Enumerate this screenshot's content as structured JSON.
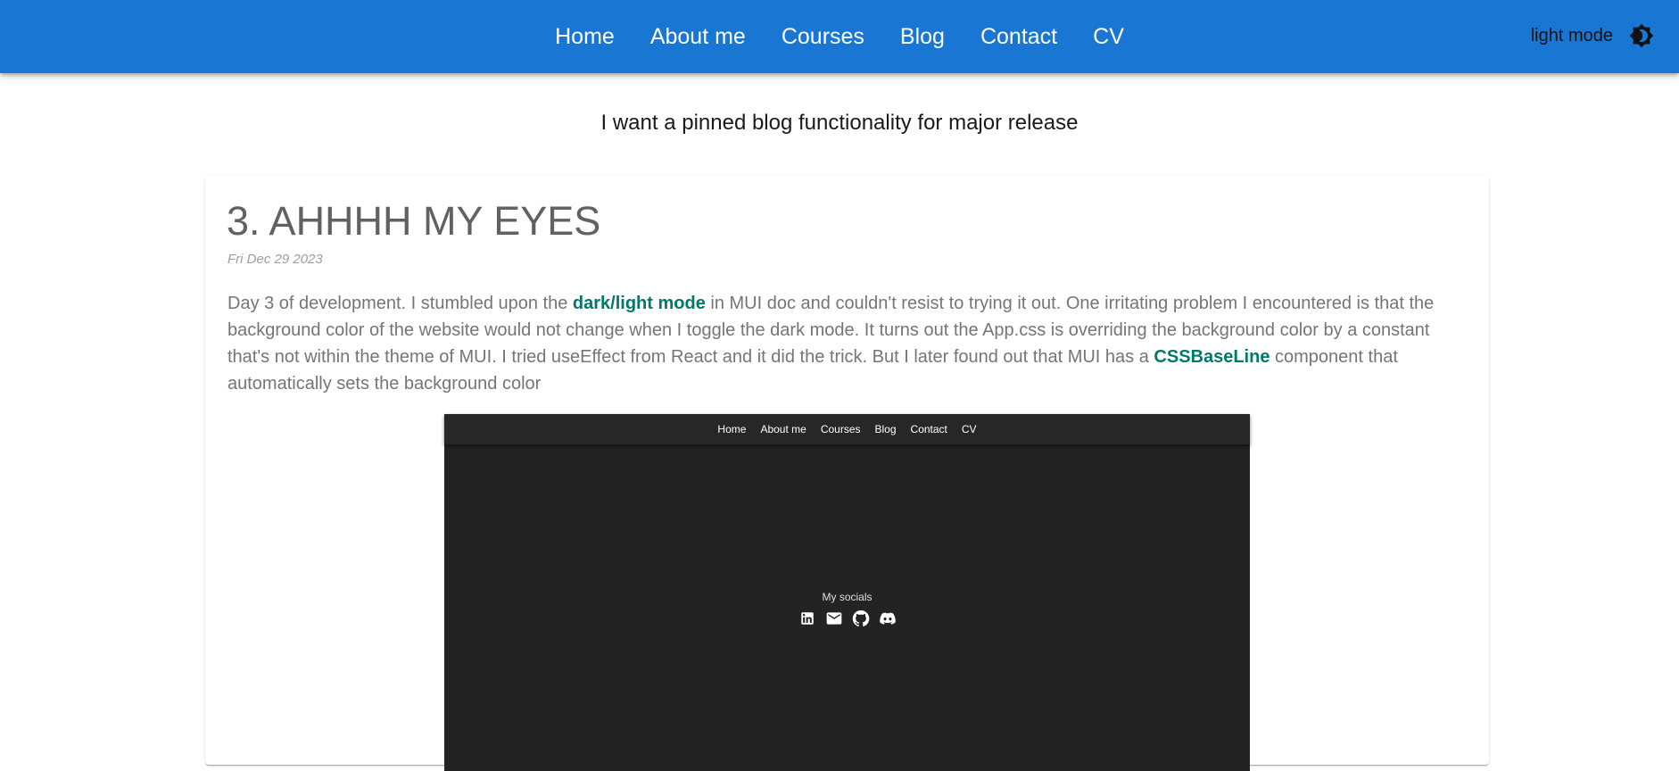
{
  "nav": {
    "items": [
      "Home",
      "About me",
      "Courses",
      "Blog",
      "Contact",
      "CV"
    ]
  },
  "theme_toggle": {
    "label": "light mode",
    "icon": "brightness-icon"
  },
  "pinned_message": "I want a pinned blog functionality for major release",
  "post": {
    "title": "3. AHHHH MY EYES",
    "date": "Fri Dec 29 2023",
    "body_part1": "Day 3 of development. I stumbled upon the ",
    "link1": "dark/light mode",
    "body_part2": " in MUI doc and couldn't resist to trying it out. One irritating problem I encountered is that the background color of the website would not change when I toggle the dark mode. It turns out the App.css is overriding the background color by a constant that's not within the theme of MUI. I tried useEffect from React and it did the trick. But I later found out that MUI has a ",
    "link2": "CSSBaseLine",
    "body_part3": " component that automatically sets the background color"
  },
  "screenshot": {
    "nav_items": [
      "Home",
      "About me",
      "Courses",
      "Blog",
      "Contact",
      "CV"
    ],
    "socials_title": "My socials",
    "social_icons": [
      "linkedin-icon",
      "email-icon",
      "github-icon",
      "discord-icon"
    ]
  },
  "colors": {
    "appbar": "#1976d2",
    "link": "#00796b",
    "body_text": "#757575",
    "dark_bg": "#232323"
  }
}
